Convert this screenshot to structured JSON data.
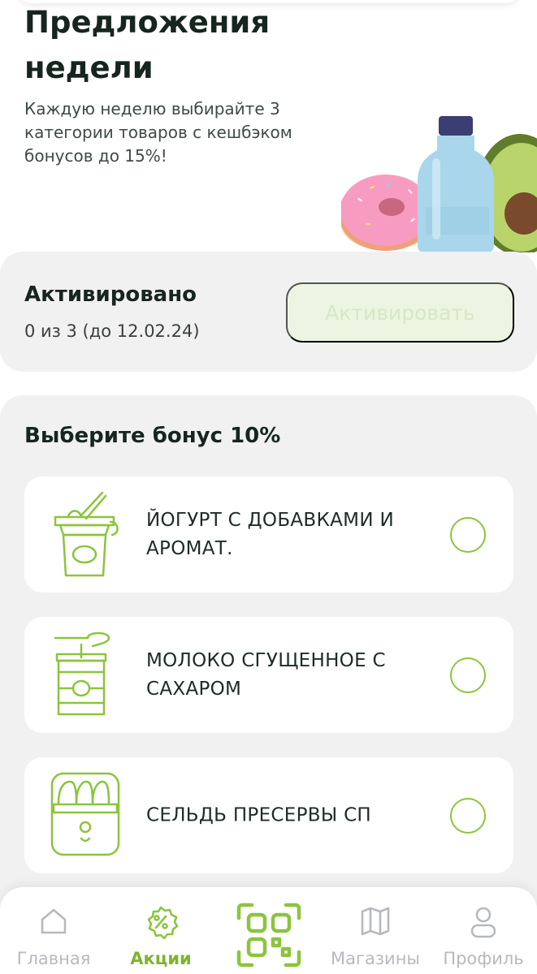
{
  "hero": {
    "title_line1": "Предложения",
    "title_line2": "недели",
    "description": "Каждую неделю выбирайте 3 категории товаров с кешбэком бонусов до 15%!"
  },
  "activation": {
    "title": "Активировано",
    "count": "0 из 3 (до 12.02.24)",
    "button_label": "Активировать"
  },
  "bonus": {
    "title": "Выберите бонус 10%",
    "items": [
      {
        "label": "ЙОГУРТ С ДОБАВКАМИ И АРОМАТ.",
        "icon": "yogurt-icon",
        "selected": false
      },
      {
        "label": "МОЛОКО СГУЩЕННОЕ С САХАРОМ",
        "icon": "condensed-milk-can-icon",
        "selected": false
      },
      {
        "label": "СЕЛЬДЬ ПРЕСЕРВЫ СП",
        "icon": "herring-preserves-icon",
        "selected": false
      }
    ]
  },
  "nav": {
    "home": "Главная",
    "promos": "Акции",
    "stores": "Магазины",
    "profile": "Профиль",
    "active": "promos"
  },
  "colors": {
    "accent": "#8cc43d",
    "accent_dark": "#7cb52f",
    "panel": "#f1f1f1",
    "button_disabled_bg": "#ecf5e1",
    "button_disabled_text": "#d6e8c4"
  }
}
